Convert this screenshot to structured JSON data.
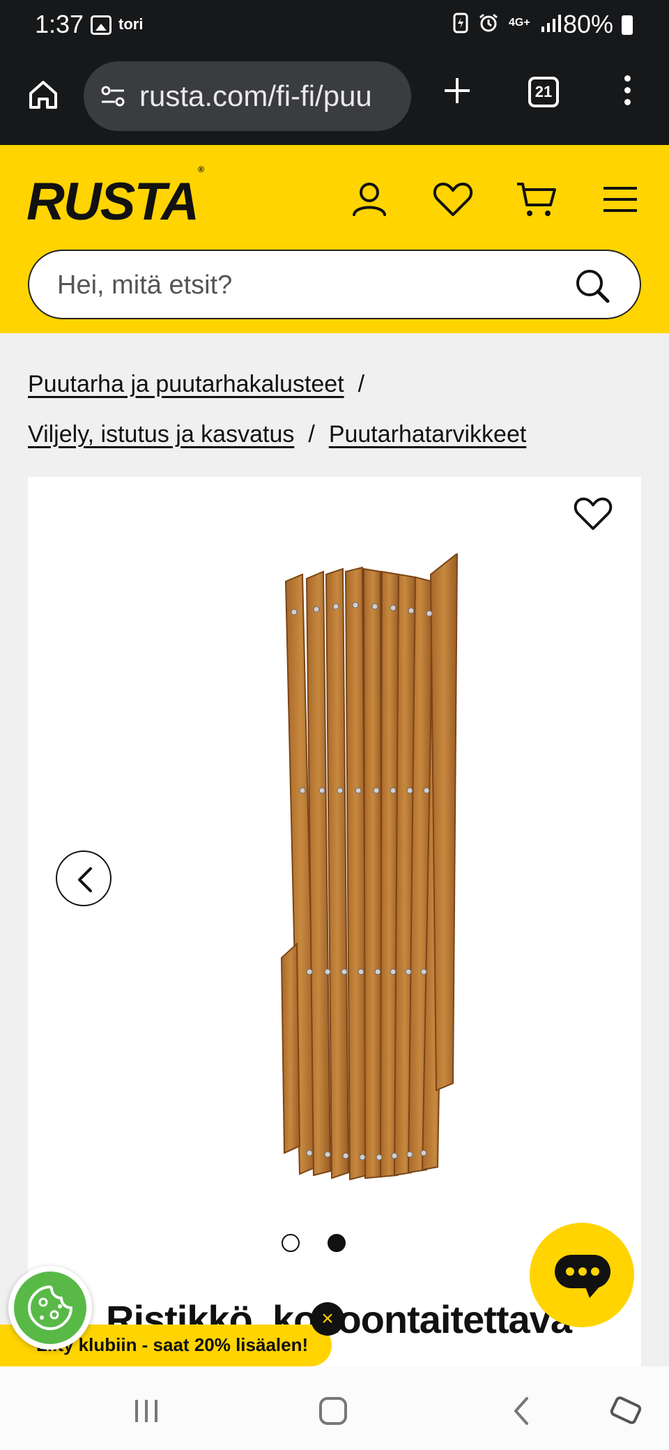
{
  "status_bar": {
    "time": "1:37",
    "app_label": "tori",
    "network": "4G+",
    "battery": "80%"
  },
  "browser": {
    "url": "rusta.com/fi-fi/puu",
    "tab_count": "21"
  },
  "header": {
    "logo": "RUSTA",
    "logo_mark": "®",
    "search_placeholder": "Hei, mitä etsit?"
  },
  "breadcrumbs": {
    "items": [
      "Puutarha ja puutarhakalusteet",
      "Viljely, istutus ja kasvatus",
      "Puutarhatarvikkeet"
    ],
    "separator": "/"
  },
  "product": {
    "title": "Ristikkö, kokoontaitettava",
    "image_icon": "wooden-expandable-trellis",
    "gallery_count": 2,
    "gallery_active_index": 1
  },
  "club_banner": {
    "text": "Liity klubiin - saat 20% lisäalen!",
    "close_symbol": "×"
  },
  "colors": {
    "brand_yellow": "#ffd400",
    "browser_bg": "#17181a",
    "cookie_green": "#58b947"
  }
}
